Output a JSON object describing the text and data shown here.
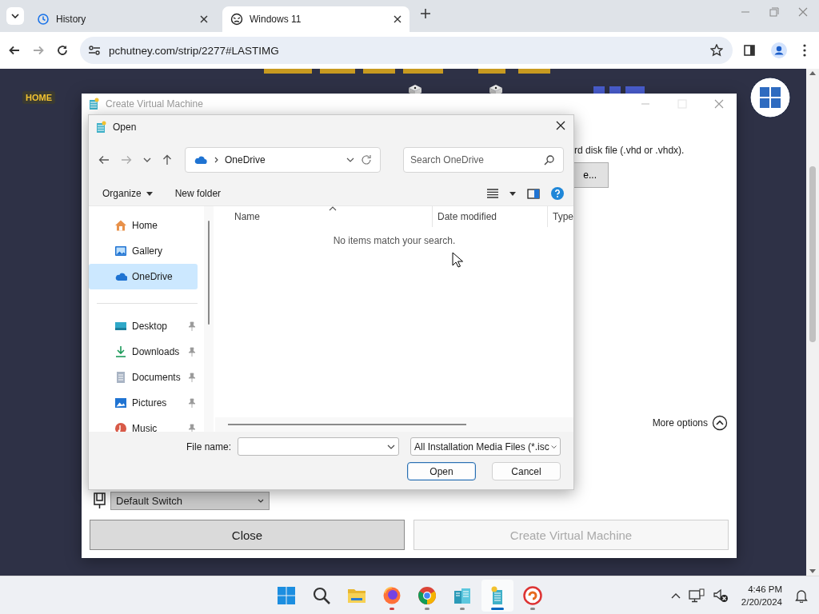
{
  "browser": {
    "tabs": [
      {
        "title": "History",
        "kind": "history",
        "selected": false
      },
      {
        "title": "Windows 11",
        "kind": "site",
        "selected": true
      }
    ],
    "nav_buttons": [
      {
        "kind": "back",
        "disabled": false
      },
      {
        "kind": "forward",
        "disabled": true
      },
      {
        "kind": "reload",
        "disabled": false
      }
    ],
    "url": "pchutney.com/strip/2277#LASTIMG"
  },
  "page": {
    "home_link": "HOME"
  },
  "vm_window": {
    "title": "Create Virtual Machine",
    "disk_text": "rd disk file (.vhd or .vhdx).",
    "browse_button": "e...",
    "more_options": "More options",
    "switch": "Default Switch",
    "buttons": [
      {
        "label": "Close",
        "disabled": false
      },
      {
        "label": "Create Virtual Machine",
        "disabled": true
      }
    ]
  },
  "open_dialog": {
    "title": "Open",
    "location": "OneDrive",
    "search": {
      "placeholder": "Search OneDrive"
    },
    "toolbar": [
      {
        "label": "Organize",
        "kind": "menu"
      },
      {
        "label": "New folder",
        "kind": "plain"
      }
    ],
    "nav_groups": [
      [
        {
          "label": "Home",
          "kind": "home",
          "pinned": false,
          "selected": false
        },
        {
          "label": "Gallery",
          "kind": "gallery",
          "pinned": false,
          "selected": false
        },
        {
          "label": "OneDrive",
          "kind": "cloud",
          "pinned": false,
          "selected": true
        }
      ],
      [
        {
          "label": "Desktop",
          "kind": "desktop",
          "pinned": true,
          "selected": false
        },
        {
          "label": "Downloads",
          "kind": "download",
          "pinned": true,
          "selected": false
        },
        {
          "label": "Documents",
          "kind": "documents",
          "pinned": true,
          "selected": false
        },
        {
          "label": "Pictures",
          "kind": "pictures",
          "pinned": true,
          "selected": false
        },
        {
          "label": "Music",
          "kind": "music",
          "pinned": true,
          "selected": false
        }
      ]
    ],
    "columns": [
      "Name",
      "Date modified",
      "Type"
    ],
    "empty_message": "No items match your search.",
    "file_name_label": "File name:",
    "file_type": "All Installation Media Files (*.isc",
    "buttons": [
      {
        "label": "Open",
        "default": true
      },
      {
        "label": "Cancel",
        "default": false
      }
    ]
  },
  "taskbar": {
    "apps": [
      {
        "kind": "start",
        "running": false,
        "attention": false,
        "active": false
      },
      {
        "kind": "search",
        "running": false,
        "attention": false,
        "active": false
      },
      {
        "kind": "folder",
        "running": false,
        "attention": false,
        "active": false
      },
      {
        "kind": "firefox",
        "running": true,
        "attention": true,
        "active": false
      },
      {
        "kind": "chrome",
        "running": true,
        "attention": false,
        "active": false
      },
      {
        "kind": "servers",
        "running": true,
        "attention": false,
        "active": false
      },
      {
        "kind": "vmwizard",
        "running": true,
        "attention": false,
        "active": true
      },
      {
        "kind": "redapp",
        "running": true,
        "attention": false,
        "active": false
      }
    ],
    "time": "4:46 PM",
    "date": "2/20/2024"
  }
}
